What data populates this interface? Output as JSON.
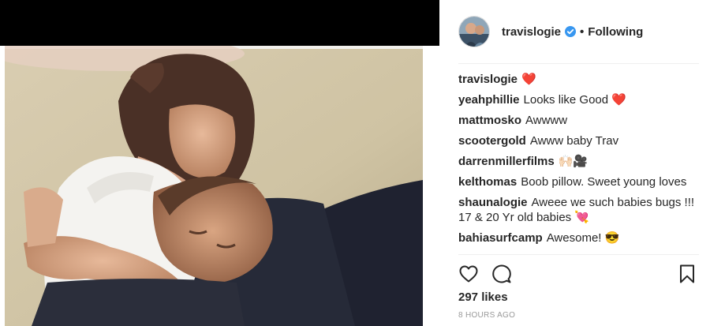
{
  "post": {
    "photo_icon": "photo-couple-sleeping",
    "header": {
      "avatar_icon": "avatar-photo-icon",
      "username": "travislogie",
      "verified_icon": "verified-badge-icon",
      "separator": "•",
      "follow_state": "Following"
    },
    "comments": [
      {
        "user": "travislogie",
        "text": "",
        "tail": "❤️"
      },
      {
        "user": "yeahphillie",
        "text": "Looks like Good",
        "tail": "❤️"
      },
      {
        "user": "mattmosko",
        "text": "Awwww",
        "tail": ""
      },
      {
        "user": "scootergold",
        "text": "Awww baby Trav",
        "tail": ""
      },
      {
        "user": "darrenmillerfilms",
        "text": "",
        "tail": "🙌🏻🎥"
      },
      {
        "user": "kelthomas",
        "text": "Boob pillow. Sweet young loves",
        "tail": ""
      },
      {
        "user": "shaunalogie",
        "text": "Aweee we such babies bugs !!! 17 & 20 Yr old babies",
        "tail": "💘"
      },
      {
        "user": "bahiasurfcamp",
        "text": "Awesome!",
        "tail": "😎"
      }
    ],
    "actions": {
      "like_icon": "heart-outline-icon",
      "comment_icon": "speech-bubble-icon",
      "save_icon": "bookmark-icon"
    },
    "likes": "297 likes",
    "timestamp": "8 HOURS AGO"
  },
  "colors": {
    "text": "#262626",
    "muted": "#999999",
    "divider": "#efefef",
    "verified": "#3897f0",
    "topbar": "#000000"
  }
}
